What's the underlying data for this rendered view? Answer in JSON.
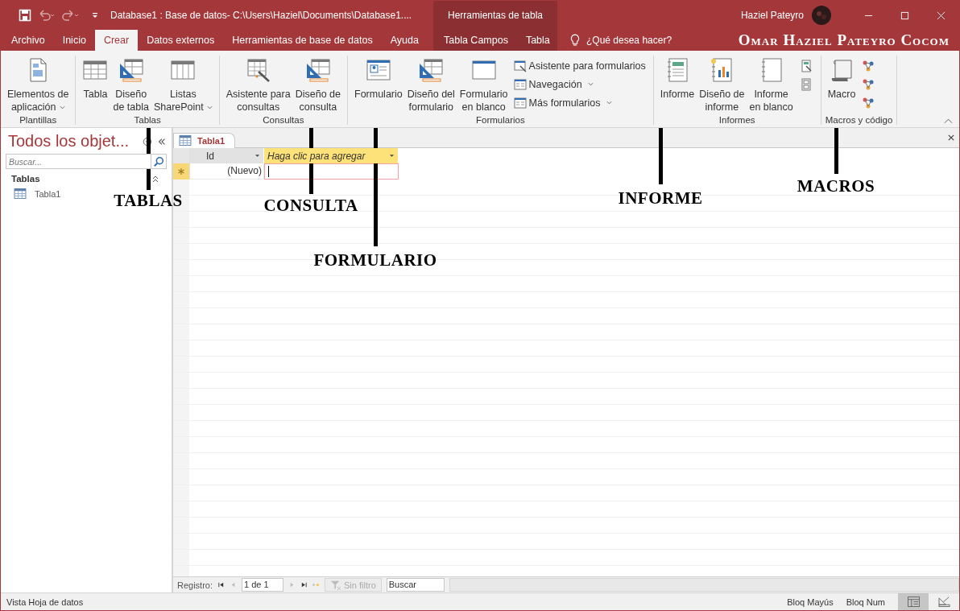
{
  "title_bar": {
    "title": "Database1 : Base de datos- C:\\Users\\Haziel\\Documents\\Database1....",
    "context_title": "Herramientas de tabla",
    "user": "Haziel Pateyro"
  },
  "tabs": [
    {
      "label": "Archivo",
      "selected": false
    },
    {
      "label": "Inicio",
      "selected": false
    },
    {
      "label": "Crear",
      "selected": true
    },
    {
      "label": "Datos externos",
      "selected": false
    },
    {
      "label": "Herramientas de base de datos",
      "selected": false
    },
    {
      "label": "Ayuda",
      "selected": false
    }
  ],
  "context_tabs": [
    {
      "label": "Tabla  Campos",
      "selected": false
    },
    {
      "label": "Tabla",
      "selected": false
    }
  ],
  "tell_me": "¿Qué desea hacer?",
  "overlay_name": "Omar Haziel Pateyro Cocom",
  "ribbon_groups": [
    {
      "label": "Plantillas",
      "items": [
        {
          "kind": "large",
          "lines": [
            "Elementos de",
            "aplicación"
          ],
          "dropdown": true
        }
      ]
    },
    {
      "label": "Tablas",
      "items": [
        {
          "kind": "large",
          "lines": [
            "Tabla"
          ],
          "dropdown": false
        },
        {
          "kind": "large",
          "lines": [
            "Diseño",
            "de tabla"
          ],
          "dropdown": false
        },
        {
          "kind": "large",
          "lines": [
            "Listas",
            "SharePoint"
          ],
          "dropdown": true
        }
      ]
    },
    {
      "label": "Consultas",
      "items": [
        {
          "kind": "large",
          "lines": [
            "Asistente para",
            "consultas"
          ],
          "dropdown": false
        },
        {
          "kind": "large",
          "lines": [
            "Diseño de",
            "consulta"
          ],
          "dropdown": false
        }
      ]
    },
    {
      "label": "Formularios",
      "items": [
        {
          "kind": "large",
          "lines": [
            "Formulario"
          ],
          "dropdown": false
        },
        {
          "kind": "large",
          "lines": [
            "Diseño del",
            "formulario"
          ],
          "dropdown": false
        },
        {
          "kind": "large",
          "lines": [
            "Formulario",
            "en blanco"
          ],
          "dropdown": false
        },
        {
          "kind": "small",
          "lines": [
            "Asistente para formularios"
          ],
          "dropdown": false
        },
        {
          "kind": "small",
          "lines": [
            "Navegación"
          ],
          "dropdown": true
        },
        {
          "kind": "small",
          "lines": [
            "Más formularios"
          ],
          "dropdown": true
        }
      ]
    },
    {
      "label": "Informes",
      "items": [
        {
          "kind": "large",
          "lines": [
            "Informe"
          ],
          "dropdown": false
        },
        {
          "kind": "large",
          "lines": [
            "Diseño de",
            "informe"
          ],
          "dropdown": false
        },
        {
          "kind": "large",
          "lines": [
            "Informe",
            "en blanco"
          ],
          "dropdown": false
        },
        {
          "kind": "icon"
        },
        {
          "kind": "icon"
        }
      ]
    },
    {
      "label": "Macros y código",
      "items": [
        {
          "kind": "large",
          "lines": [
            "Macro"
          ],
          "dropdown": false
        },
        {
          "kind": "icon"
        },
        {
          "kind": "icon"
        },
        {
          "kind": "icon"
        }
      ]
    }
  ],
  "nav_pane": {
    "title": "Todos los objet...",
    "search_placeholder": "Buscar...",
    "section": "Tablas",
    "items": [
      "Tabla1"
    ]
  },
  "document_tab": "Tabla1",
  "datasheet": {
    "columns": [
      {
        "label": "Id",
        "kind": "field"
      },
      {
        "label": "Haga clic para agregar",
        "kind": "add"
      }
    ],
    "new_row": "(Nuevo)"
  },
  "record_nav": {
    "label": "Registro:",
    "position": "1 de 1",
    "filter": "Sin filtro",
    "search": "Buscar"
  },
  "status_bar": {
    "view": "Vista Hoja de datos",
    "indicators": [
      "Bloq Mayús",
      "Bloq Num"
    ],
    "views": [
      {
        "selected": true
      },
      {
        "selected": false
      }
    ]
  },
  "annotations": [
    {
      "label": "TABLAS"
    },
    {
      "label": "CONSULTA"
    },
    {
      "label": "FORMULARIO"
    },
    {
      "label": "INFORME"
    },
    {
      "label": "MACROS"
    }
  ]
}
